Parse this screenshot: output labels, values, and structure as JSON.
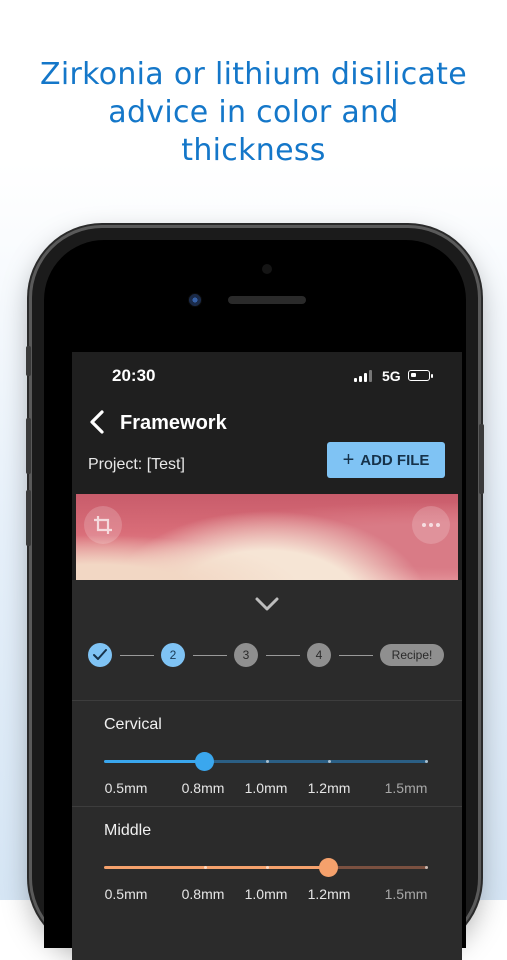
{
  "headline": {
    "lines": [
      "Zirkonia or lithium disilicate",
      "advice in color and",
      "thickness"
    ]
  },
  "status_bar": {
    "time": "20:30",
    "network": "5G",
    "icons": [
      "signal-bars-icon",
      "battery-icon"
    ]
  },
  "nav": {
    "title": "Framework",
    "back_icon": "chevron-left-icon"
  },
  "project": {
    "label": "Project: [Test]"
  },
  "add_file": {
    "label": "ADD FILE",
    "icon": "plus-icon"
  },
  "photo": {
    "crop_icon": "crop-icon",
    "more_icon": "more-dots-icon"
  },
  "panel": {
    "collapse_icon": "chevron-down-icon"
  },
  "stepper": {
    "steps": [
      {
        "label": "",
        "state": "done",
        "icon": "check-icon"
      },
      {
        "label": "2",
        "state": "active"
      },
      {
        "label": "3",
        "state": "todo"
      },
      {
        "label": "4",
        "state": "todo"
      }
    ],
    "final_label": "Recipe!"
  },
  "sliders": [
    {
      "label": "Cervical",
      "color": "#3aa7ee",
      "value_label": "0.8mm",
      "ticks": [
        "0.5mm",
        "0.8mm",
        "1.0mm",
        "1.2mm",
        "1.5mm"
      ]
    },
    {
      "label": "Middle",
      "color": "#f5a16c",
      "value_label": "1.2mm",
      "ticks": [
        "0.5mm",
        "0.8mm",
        "1.0mm",
        "1.2mm",
        "1.5mm"
      ]
    }
  ],
  "colors": {
    "headline": "#1477c9",
    "accent": "#7fc3f4",
    "screen_bg": "#1f1f1f",
    "panel_bg": "#2b2b2b"
  }
}
